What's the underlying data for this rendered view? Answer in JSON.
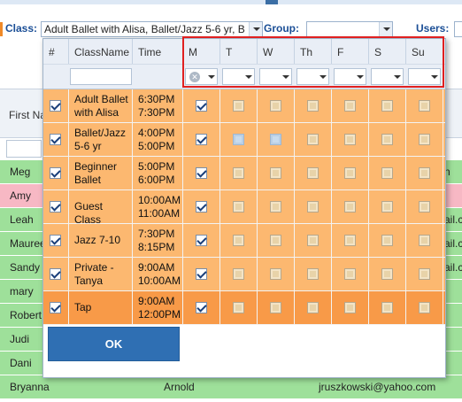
{
  "filters": {
    "class_label": "Class:",
    "class_value": "Adult Ballet with Alisa, Ballet/Jazz 5-6 yr, B",
    "group_label": "Group:",
    "group_value": "",
    "users_label": "Users:"
  },
  "background": {
    "header_first_name": "First Na",
    "rows": [
      {
        "name": "Meg",
        "tail": "n",
        "last": "",
        "email": ""
      },
      {
        "name": "Amy",
        "tail": "",
        "last": "",
        "email": ""
      },
      {
        "name": "Leah",
        "tail": "ail.c",
        "last": "",
        "email": ""
      },
      {
        "name": "Mauree",
        "tail": "ail.c",
        "last": "",
        "email": ""
      },
      {
        "name": "Sandy",
        "tail": "ail.c",
        "last": "",
        "email": ""
      },
      {
        "name": "mary",
        "tail": "",
        "last": "",
        "email": ""
      },
      {
        "name": "Robert",
        "tail": "",
        "last": "",
        "email": ""
      },
      {
        "name": "Judi",
        "tail": "",
        "last": "",
        "email": ""
      },
      {
        "name": "Dani",
        "tail": "",
        "last": "",
        "email": ""
      },
      {
        "name": "Bryanna",
        "tail": "",
        "last": "Arnold",
        "email": "jruszkowski@yahoo.com"
      }
    ]
  },
  "popup": {
    "columns": {
      "num": "#",
      "classname": "ClassName",
      "time": "Time",
      "days": [
        "M",
        "T",
        "W",
        "Th",
        "F",
        "S",
        "Su"
      ]
    },
    "rows": [
      {
        "checked": true,
        "name": "Adult Ballet\nwith Alisa",
        "time": "6:30PM\n7:30PM",
        "days": [
          true,
          false,
          false,
          false,
          false,
          false,
          false
        ]
      },
      {
        "checked": true,
        "name": "Ballet/Jazz\n5-6 yr",
        "time": "4:00PM\n5:00PM",
        "days": [
          true,
          false,
          false,
          false,
          false,
          false,
          false
        ]
      },
      {
        "checked": true,
        "name": "Beginner\nBallet",
        "time": "5:00PM\n6:00PM",
        "days": [
          true,
          false,
          false,
          false,
          false,
          false,
          false
        ]
      },
      {
        "checked": true,
        "name": "Guest Class",
        "time": "10:00AM\n11:00AM",
        "days": [
          true,
          false,
          false,
          false,
          false,
          false,
          false
        ]
      },
      {
        "checked": true,
        "name": "Jazz 7-10",
        "time": "7:30PM\n8:15PM",
        "days": [
          true,
          false,
          false,
          false,
          false,
          false,
          false
        ]
      },
      {
        "checked": true,
        "name": "Private -\nTanya",
        "time": "9:00AM\n10:00AM",
        "days": [
          true,
          false,
          false,
          false,
          false,
          false,
          false
        ]
      },
      {
        "checked": true,
        "name": "Tap",
        "time": "9:00AM\n12:00PM",
        "days": [
          true,
          false,
          false,
          false,
          false,
          false,
          false
        ]
      }
    ],
    "ok_label": "OK"
  },
  "colors": {
    "row_orange": "#fcb870",
    "row_selected": "#f89a48",
    "bg_green": "#9ee09a",
    "bg_pink": "#f7b8c4",
    "highlight_red": "#e02020",
    "ok_blue": "#2f6fb3"
  }
}
